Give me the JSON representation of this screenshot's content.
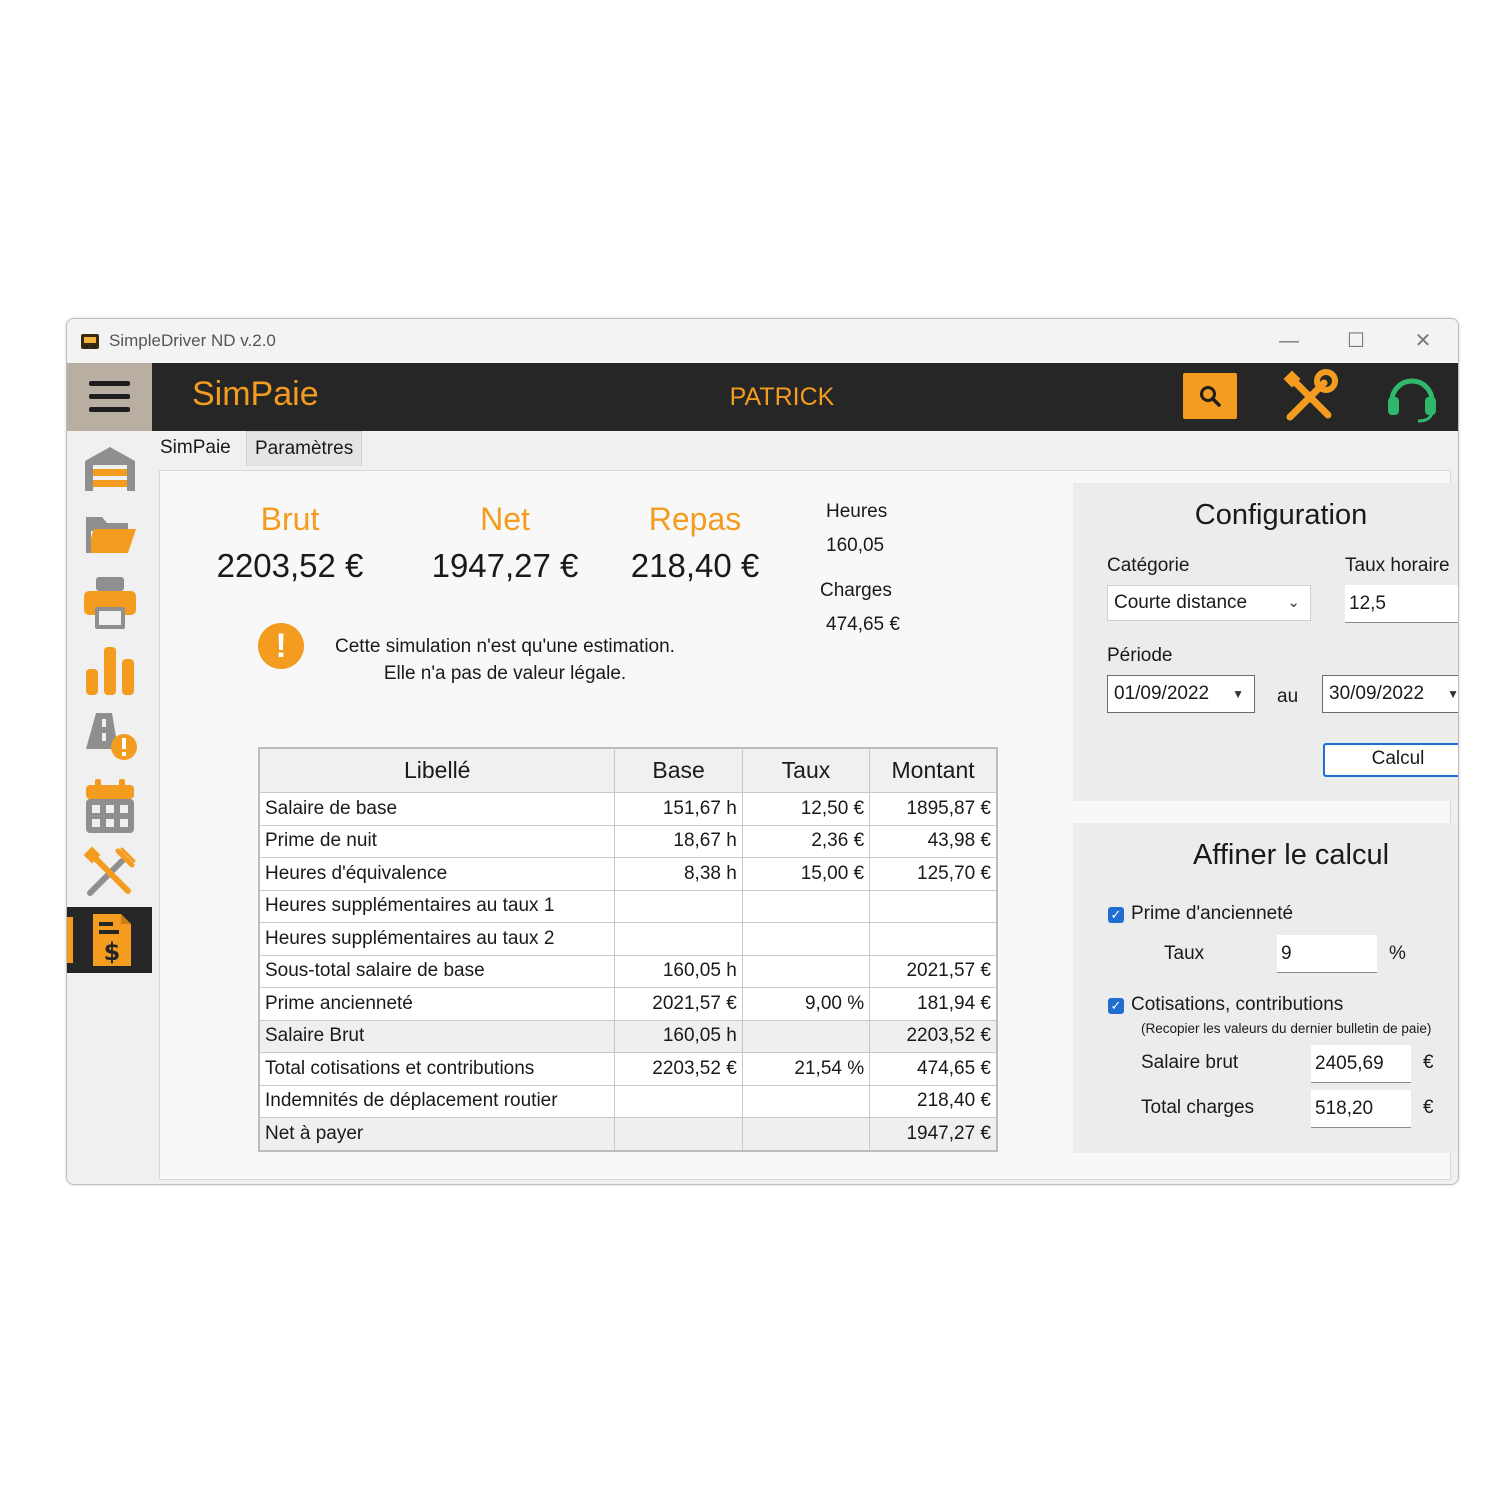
{
  "window": {
    "title": "SimpleDriver ND v.2.0",
    "controls": {
      "minimize": "—",
      "maximize": "☐",
      "close": "✕"
    }
  },
  "header": {
    "app_name": "SimPaie",
    "user": "PATRICK",
    "icons": [
      "search-icon",
      "tools-icon",
      "support-headset-icon"
    ],
    "accent_color": "#f39c1f",
    "bar_color": "#262626"
  },
  "sidebar": {
    "items": [
      {
        "icon": "garage-icon"
      },
      {
        "icon": "folder-icon"
      },
      {
        "icon": "printer-icon"
      },
      {
        "icon": "bar-chart-icon"
      },
      {
        "icon": "road-warning-icon"
      },
      {
        "icon": "calendar-icon"
      },
      {
        "icon": "tools-icon"
      },
      {
        "icon": "payslip-dollar-icon",
        "active": true
      }
    ]
  },
  "tabs": [
    {
      "label": "SimPaie",
      "active": true
    },
    {
      "label": "Paramètres",
      "active": false
    }
  ],
  "summary": {
    "brut": {
      "label": "Brut",
      "value": "2203,52 €"
    },
    "net": {
      "label": "Net",
      "value": "1947,27 €"
    },
    "repas": {
      "label": "Repas",
      "value": "218,40 €"
    },
    "heures": {
      "label": "Heures",
      "value": "160,05"
    },
    "charges": {
      "label": "Charges",
      "value": "474,65 €"
    }
  },
  "warning": {
    "icon": "exclamation-icon",
    "line1": "Cette simulation n'est qu'une estimation.",
    "line2": "Elle n'a pas de valeur légale."
  },
  "table": {
    "headers": [
      "Libellé",
      "Base",
      "Taux",
      "Montant"
    ],
    "rows": [
      [
        "Salaire de base",
        "151,67 h",
        "12,50 €",
        "1895,87 €"
      ],
      [
        "Prime de nuit",
        "18,67 h",
        "2,36 €",
        "43,98 €"
      ],
      [
        "Heures d'équivalence",
        "8,38 h",
        "15,00 €",
        "125,70 €"
      ],
      [
        "Heures supplémentaires au taux 1",
        "",
        "",
        ""
      ],
      [
        "Heures supplémentaires au taux 2",
        "",
        "",
        ""
      ],
      [
        "Sous-total salaire de base",
        "160,05 h",
        "",
        "2021,57 €"
      ],
      [
        "Prime ancienneté",
        "2021,57 €",
        "9,00 %",
        "181,94 €"
      ],
      [
        "Salaire Brut",
        "160,05 h",
        "",
        "2203,52 €"
      ],
      [
        "Total cotisations et contributions",
        "2203,52 €",
        "21,54 %",
        "474,65 €"
      ],
      [
        "Indemnités de déplacement routier",
        "",
        "",
        "218,40 €"
      ],
      [
        "Net à payer",
        "",
        "",
        "1947,27 €"
      ]
    ],
    "shaded_rows": [
      7,
      10
    ]
  },
  "configuration": {
    "title": "Configuration",
    "categorie_label": "Catégorie",
    "categorie_value": "Courte distance",
    "taux_horaire_label": "Taux horaire",
    "taux_horaire_value": "12,5",
    "taux_unit": "€",
    "periode_label": "Période",
    "date_from": "01/09/2022",
    "au_label": "au",
    "date_to": "30/09/2022",
    "calc_button": "Calcul"
  },
  "affiner": {
    "title": "Affiner le calcul",
    "prime_label": "Prime d'ancienneté",
    "prime_checked": true,
    "taux_label": "Taux",
    "taux_value": "9",
    "taux_unit": "%",
    "cotisations_label": "Cotisations, contributions",
    "cotisations_checked": true,
    "note": "(Recopier les valeurs du dernier bulletin de paie)",
    "salaire_brut_label": "Salaire brut",
    "salaire_brut_value": "2405,69",
    "salaire_unit": "€",
    "total_charges_label": "Total charges",
    "total_charges_value": "518,20",
    "charges_unit": "€"
  }
}
